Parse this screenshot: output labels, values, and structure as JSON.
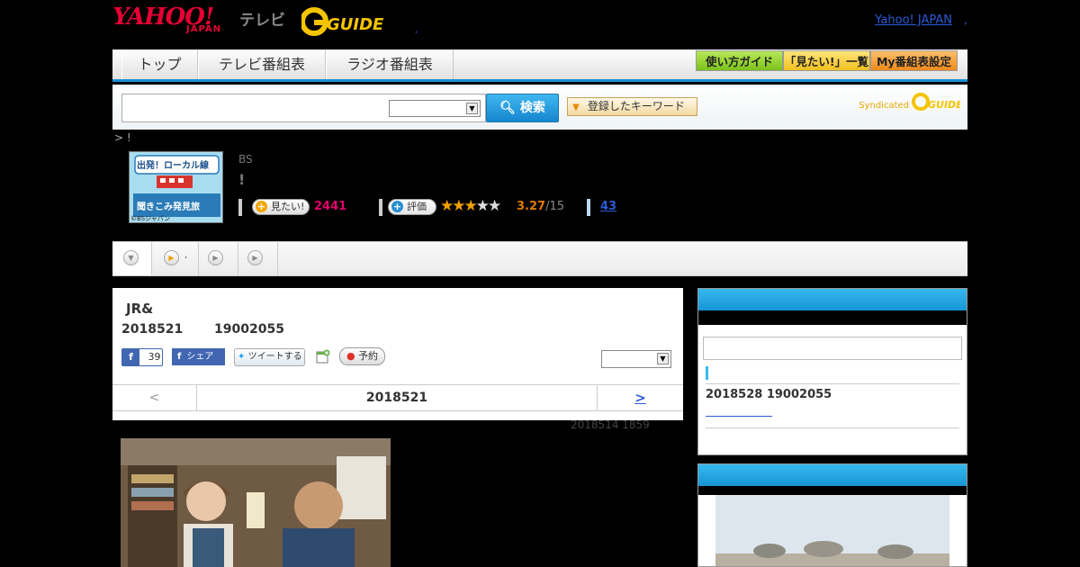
{
  "header": {
    "yahoo_logo": "YAHOO!",
    "japan_logo": "JAPAN",
    "tv_logo": "テレビ",
    "gguide_logo": "G GUIDE",
    "dot": ",",
    "yahoo_japan_link": "Yahoo! JAPAN",
    "link_dot": ","
  },
  "nav": {
    "tabs": [
      "トップ",
      "テレビ番組表",
      "ラジオ番組表"
    ],
    "buttons": [
      "使い方ガイド",
      "「見たい!」一覧",
      "My番組表設定"
    ]
  },
  "search": {
    "input_value": "",
    "select_value": "",
    "button_label": "検索",
    "keyword_button": "登録したキーワード",
    "syndicated": "Syndicated"
  },
  "breadcrumb": "> !",
  "program": {
    "thumb_text_top": "出発！ローカル線",
    "thumb_text_bottom": "聞きこみ発見旅",
    "thumb_credit": "©BSジャパン",
    "channel": "BS",
    "title": "!",
    "mitai_label": "見たい!",
    "mitai_count": "2441",
    "rating_label": "評価",
    "rating_stars": 3,
    "rating_max_stars": 5,
    "score": "3.27",
    "score_max": "/15",
    "reviews": "43"
  },
  "episode": {
    "title": "JR&",
    "date": "2018521",
    "time": "19002055",
    "fb_like_count": "39",
    "fb_share": "シェア",
    "tweet": "ツイートする",
    "reserve": "予約",
    "select_value": "",
    "pager_prev": "<",
    "pager_date": "2018521",
    "pager_next": ">",
    "previous_air": "2018514  1859"
  },
  "sidebar": {
    "next_air": "2018528  19002055"
  },
  "colors": {
    "accent_blue": "#1795d6",
    "mitai_pink": "#e2006a",
    "score_orange": "#e07a00",
    "link_blue": "#2a5bd7"
  }
}
